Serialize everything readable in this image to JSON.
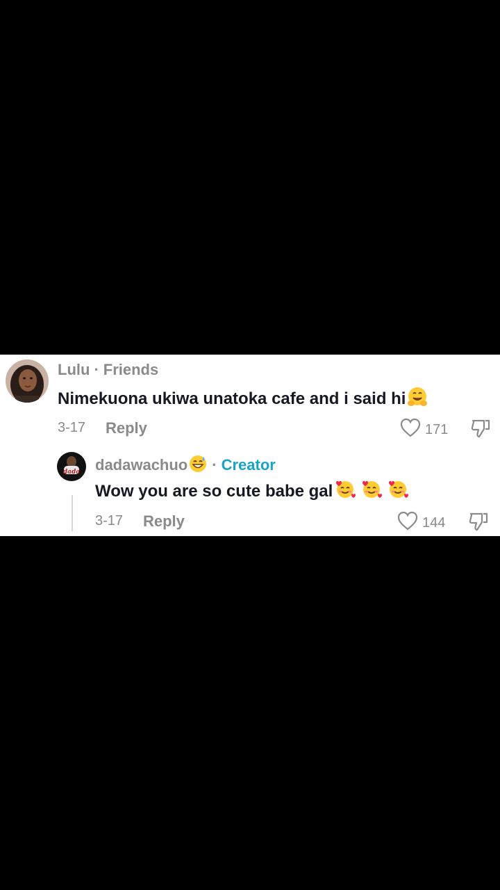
{
  "comments": [
    {
      "username": "Lulu",
      "badge": "Friends",
      "text": "Nimekuona ukiwa unatoka cafe and i said hi",
      "emoji": "hugging-face",
      "date": "3-17",
      "reply_label": "Reply",
      "likes": "171"
    }
  ],
  "reply": {
    "username": "dadawachuo",
    "username_emoji": "grinning-sweat",
    "badge": "Creator",
    "text": "Wow you are so cute babe gal",
    "emojis": [
      "smiling-hearts",
      "smiling-hearts",
      "smiling-hearts"
    ],
    "date": "3-17",
    "reply_label": "Reply",
    "likes": "144"
  },
  "colors": {
    "background": "#000000",
    "panel": "#ffffff",
    "muted": "#8a8a8a",
    "creator": "#1aa3c9",
    "text": "#161823"
  }
}
